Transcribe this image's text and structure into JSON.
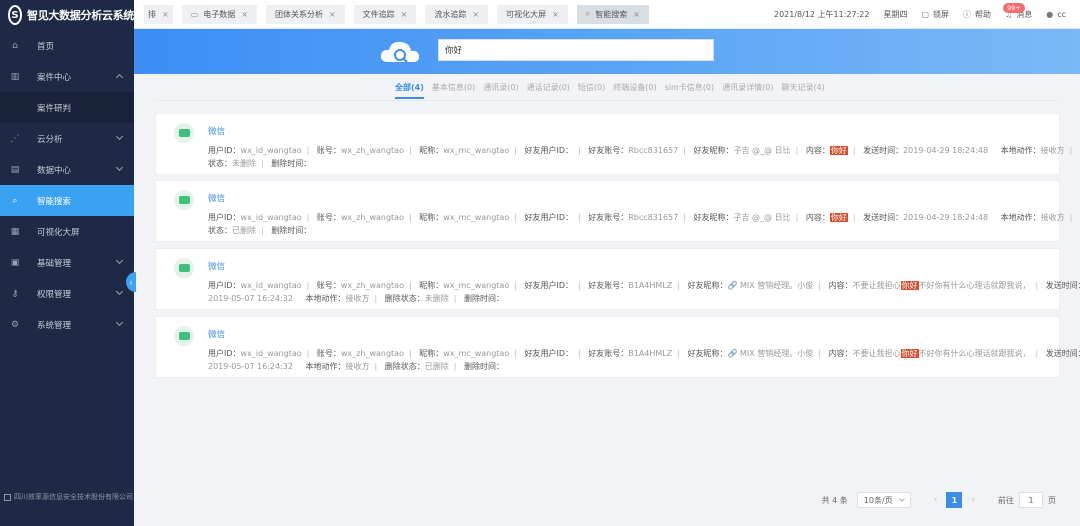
{
  "sidebar": {
    "logo_text": "智见大数据分析云系统",
    "items": [
      {
        "label": "首页",
        "icon": "home-icon",
        "glyph": "⌂"
      },
      {
        "label": "案件中心",
        "icon": "case-icon",
        "glyph": "▥"
      },
      {
        "label": "案件研判",
        "icon": "",
        "glyph": ""
      },
      {
        "label": "云分析",
        "icon": "share-icon",
        "glyph": "⋰"
      },
      {
        "label": "数据中心",
        "icon": "data-icon",
        "glyph": "▤"
      },
      {
        "label": "智能搜索",
        "icon": "search-icon",
        "glyph": "⌕"
      },
      {
        "label": "可视化大屏",
        "icon": "screen-icon",
        "glyph": "▦"
      },
      {
        "label": "基础管理",
        "icon": "grid-icon",
        "glyph": "▣"
      },
      {
        "label": "权限管理",
        "icon": "permission-icon",
        "glyph": "⚷"
      },
      {
        "label": "系统管理",
        "icon": "gear-icon",
        "glyph": "⚙"
      }
    ],
    "footer": "四川效率源信息安全技术股份有限公司"
  },
  "tabs": {
    "first": "排",
    "items": [
      {
        "label": "电子数据",
        "glyph": "▭"
      },
      {
        "label": "团体关系分析",
        "glyph": ""
      },
      {
        "label": "文件追踪",
        "glyph": ""
      },
      {
        "label": "流水追踪",
        "glyph": ""
      },
      {
        "label": "可视化大屏",
        "glyph": ""
      },
      {
        "label": "智能搜索",
        "glyph": "⌕"
      }
    ],
    "close": "×"
  },
  "header": {
    "datetime": "2021/8/12 上午11:27:22",
    "weekday": "星期四",
    "lock_label": "锁屏",
    "help_label": "帮助",
    "message_label": "消息",
    "message_badge": "99+",
    "user_name": "cc"
  },
  "search": {
    "value": "你好"
  },
  "filters": [
    "全部(4)",
    "基本信息(0)",
    "通讯录(0)",
    "通话记录(0)",
    "短信(0)",
    "终端设备(0)",
    "sim卡信息(0)",
    "通讯录详情(0)",
    "聊天记录(4)"
  ],
  "labels": {
    "user_id": "用户ID：",
    "account": "账号：",
    "nickname": "昵称：",
    "friend_user_id": "好友用户ID：",
    "friend_account": "好友账号：",
    "friend_nickname": "好友昵称：",
    "content": "内容：",
    "send_time": "发送时间：",
    "local_action": "本地动作：",
    "delete": "删除",
    "delete_status": "状态：",
    "delete_status_full": "删除状态：",
    "delete_time": "删除时间："
  },
  "results": [
    {
      "title": "微信",
      "user_id": "wx_id_wangtao",
      "account": "wx_zh_wangtao",
      "nickname": "wx_mc_wangtao",
      "friend_account": "Rbcc831657",
      "friend_nickname": "子吉 @_@ 日比",
      "content_pre": "",
      "keyword": "你好",
      "content_post": "",
      "send_time": "2019-04-29 18:24:48",
      "local_action": "接收方",
      "delete_status": "未删除"
    },
    {
      "title": "微信",
      "user_id": "wx_id_wangtao",
      "account": "wx_zh_wangtao",
      "nickname": "wx_mc_wangtao",
      "friend_account": "Rbcc831657",
      "friend_nickname": "子吉 @_@ 日比",
      "content_pre": "",
      "keyword": "你好",
      "content_post": "",
      "send_time": "2019-04-29 18:24:48",
      "local_action": "接收方",
      "delete_status": "已删除"
    },
    {
      "title": "微信",
      "user_id": "wx_id_wangtao",
      "account": "wx_zh_wangtao",
      "nickname": "wx_mc_wangtao",
      "friend_account": "B1A4HMLZ",
      "friend_nickname": "🔗 MIX 营销经理。小俊",
      "content_pre": "不要让我担心",
      "keyword": "你好",
      "content_post": "不好你有什么心理话就跟我说，",
      "send_time": "2019-05-07 16:24:32",
      "local_action": "接收方",
      "delete_status": "未删除"
    },
    {
      "title": "微信",
      "user_id": "wx_id_wangtao",
      "account": "wx_zh_wangtao",
      "nickname": "wx_mc_wangtao",
      "friend_account": "B1A4HMLZ",
      "friend_nickname": "🔗 MIX 营销经理。小俊",
      "content_pre": "不要让我担心",
      "keyword": "你好",
      "content_post": "不好你有什么心理话就跟我说，",
      "send_time": "2019-05-07 16:24:32",
      "local_action": "接收方",
      "delete_status": "已删除"
    }
  ],
  "pagination": {
    "total": "共 4 条",
    "page_size": "10条/页",
    "prev": "‹",
    "current": "1",
    "next": "›",
    "goto_label": "前往",
    "goto_value": "1",
    "page_suffix": "页"
  },
  "colors": {
    "sidebar_bg": "#1e2a45",
    "accent": "#3aa2f2",
    "highlight": "#d9502e",
    "wechat_green": "#3fbf7a"
  }
}
